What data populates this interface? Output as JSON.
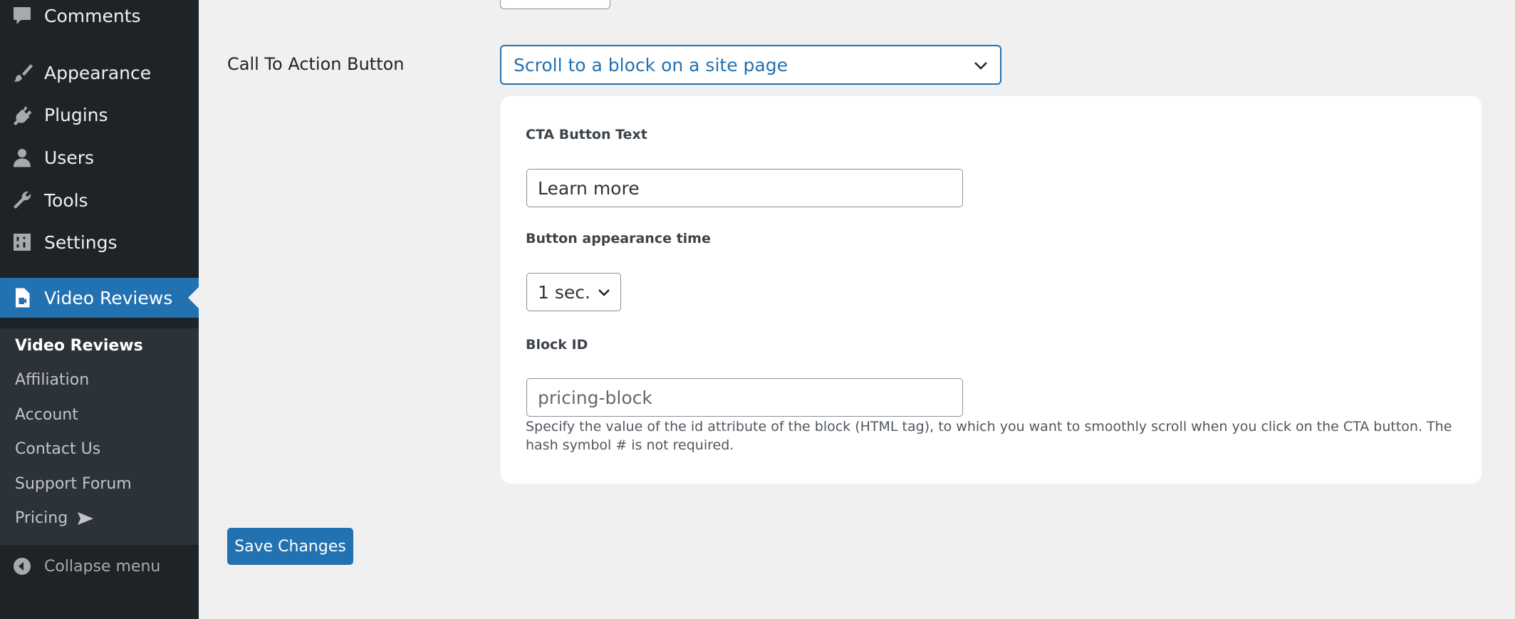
{
  "sidebar": {
    "items": [
      {
        "label": "Comments",
        "icon": "comment-icon"
      },
      {
        "label": "Appearance",
        "icon": "paintbrush-icon"
      },
      {
        "label": "Plugins",
        "icon": "plug-icon"
      },
      {
        "label": "Users",
        "icon": "user-icon"
      },
      {
        "label": "Tools",
        "icon": "wrench-icon"
      },
      {
        "label": "Settings",
        "icon": "settings-sliders-icon"
      },
      {
        "label": "Video Reviews",
        "icon": "video-document-icon"
      }
    ],
    "submenu": [
      {
        "label": "Video Reviews"
      },
      {
        "label": "Affiliation"
      },
      {
        "label": "Account"
      },
      {
        "label": "Contact Us"
      },
      {
        "label": "Support Forum"
      },
      {
        "label": "Pricing"
      }
    ],
    "collapse_label": "Collapse menu",
    "active_color": "#2271b1",
    "background_color": "#1d2327"
  },
  "form": {
    "cta": {
      "label": "Call To Action Button",
      "selected": "Scroll to a block on a site page"
    },
    "cta_text": {
      "label": "CTA Button Text",
      "value": "Learn more"
    },
    "appearance_time": {
      "label": "Button appearance time",
      "selected": "1 sec."
    },
    "block_id": {
      "label": "Block ID",
      "placeholder": "pricing-block",
      "help": "Specify the value of the id attribute of the block (HTML tag), to which you want to smoothly scroll when you click on the CTA button. The hash symbol # is not required."
    },
    "save_label": "Save Changes"
  }
}
